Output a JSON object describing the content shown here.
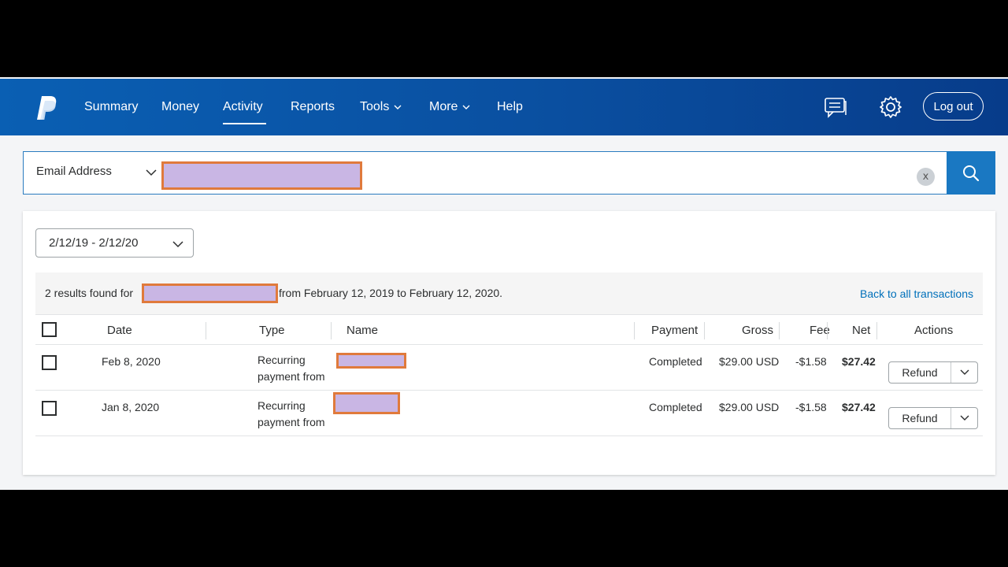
{
  "nav": {
    "items": [
      {
        "label": "Summary"
      },
      {
        "label": "Money"
      },
      {
        "label": "Activity",
        "active": true
      },
      {
        "label": "Reports"
      },
      {
        "label": "Tools",
        "has_dropdown": true
      },
      {
        "label": "More",
        "has_dropdown": true
      },
      {
        "label": "Help"
      }
    ],
    "logout_label": "Log out",
    "icons": [
      "paypal-logo",
      "message-center-icon",
      "gear-icon"
    ]
  },
  "search": {
    "type_label": "Email Address",
    "value_redacted": true,
    "clear_label": "x"
  },
  "filter": {
    "date_range": "2/12/19 - 2/12/20"
  },
  "results": {
    "prefix": "2 results found for",
    "suffix": "from February 12, 2019 to February 12, 2020.",
    "back_link": "Back to all transactions"
  },
  "table": {
    "headers": {
      "date": "Date",
      "type": "Type",
      "name": "Name",
      "payment": "Payment",
      "gross": "Gross",
      "fee": "Fee",
      "net": "Net",
      "actions": "Actions"
    },
    "rows": [
      {
        "date": "Feb 8, 2020",
        "type_line1": "Recurring",
        "type_line2": "payment from",
        "payment": "Completed",
        "gross": "$29.00 USD",
        "fee": "-$1.58",
        "net": "$27.42",
        "action": "Refund"
      },
      {
        "date": "Jan 8, 2020",
        "type_line1": "Recurring",
        "type_line2": "payment from",
        "payment": "Completed",
        "gross": "$29.00 USD",
        "fee": "-$1.58",
        "net": "$27.42",
        "action": "Refund"
      }
    ]
  },
  "colors": {
    "header_start": "#0a5fb3",
    "header_end": "#073c8a",
    "link": "#0070ba",
    "search_button": "#1a78c2",
    "redaction_fill": "#c9b6e4",
    "redaction_border": "#e07a3c"
  }
}
